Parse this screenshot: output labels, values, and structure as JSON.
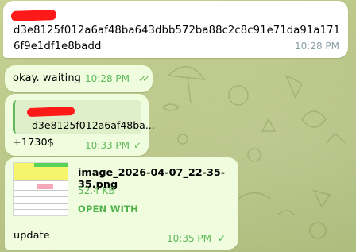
{
  "chat": {
    "wallpaper_color": "#bfcb8c",
    "incoming_bubble_color": "#ffffff",
    "outgoing_bubble_color": "#effdde",
    "accent_green": "#5fb85a",
    "redaction_color": "#ff1a1a"
  },
  "messages": [
    {
      "direction": "incoming",
      "sender_redacted": true,
      "text": "d3e8125f012a6af48ba643dbb572ba88c2c8c91e71da91a1716f9e1df1e8badd",
      "time": "10:28 PM"
    },
    {
      "direction": "outgoing",
      "text": "okay. waiting",
      "time": "10:28 PM",
      "status": "read",
      "status_icon": "double-check-icon"
    },
    {
      "direction": "outgoing",
      "reply": {
        "sender_redacted": true,
        "preview": "d3e8125f012a6af48ba..."
      },
      "text": "+1730$",
      "time": "10:33 PM",
      "status": "sent",
      "status_icon": "single-check-icon"
    },
    {
      "direction": "outgoing",
      "attachment": {
        "file_name": "image_2026-04-07_22-35-35.png",
        "file_size": "52.4 KB",
        "action": "OPEN WITH",
        "thumbnail_icon": "spreadsheet-thumbnail"
      },
      "text": "update",
      "time": "10:35 PM",
      "status": "sent",
      "status_icon": "single-check-icon"
    }
  ]
}
